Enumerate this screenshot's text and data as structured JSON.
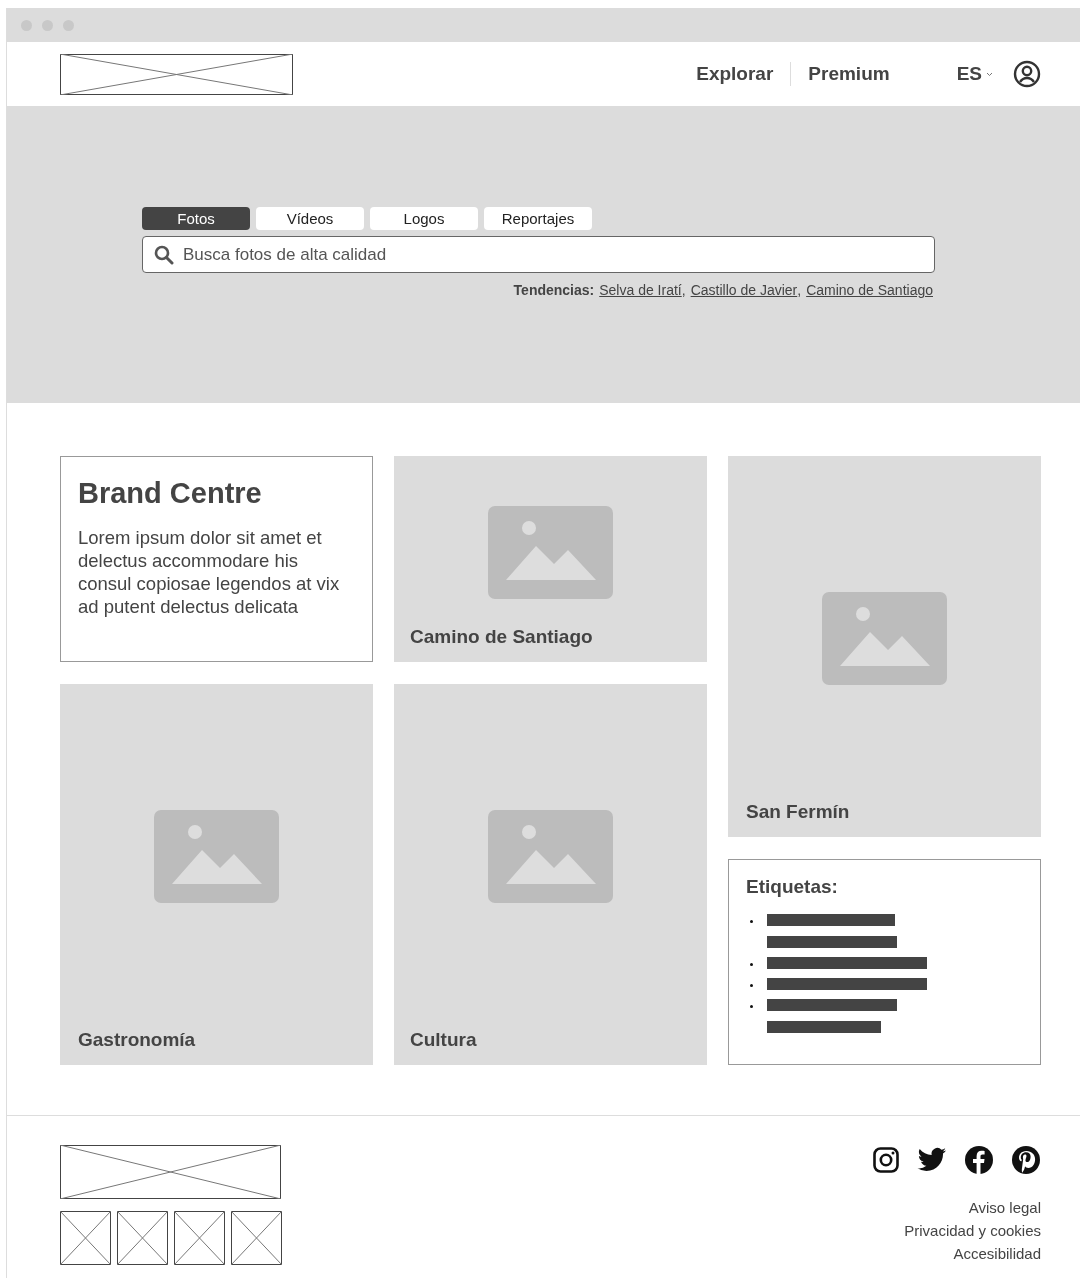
{
  "header": {
    "nav": [
      {
        "label": "Explorar"
      },
      {
        "label": "Premium"
      }
    ],
    "language": "ES"
  },
  "hero": {
    "tabs": [
      {
        "label": "Fotos",
        "selected": true
      },
      {
        "label": "Vídeos",
        "selected": false
      },
      {
        "label": "Logos",
        "selected": false
      },
      {
        "label": "Reportajes",
        "selected": false
      }
    ],
    "search": {
      "placeholder": "Busca fotos de alta calidad"
    },
    "trends_label": "Tendencias:",
    "trends_separator": ",",
    "trends": [
      "Selva de Iratí",
      "Castillo de Javier",
      "Camino de Santiago"
    ]
  },
  "intro": {
    "title": "Brand Centre",
    "text": "Lorem ipsum dolor sit amet et delectus accommodare his consul copiosae legendos at vix ad putent delectus delicata"
  },
  "tiles": [
    {
      "label": "Camino de Santiago",
      "kind": "picture"
    },
    {
      "label": "San Fermín",
      "kind": "picture"
    },
    {
      "label": "Gastronomía",
      "kind": "picture"
    },
    {
      "label": "Cultura",
      "kind": "picture"
    }
  ],
  "tags": {
    "title": "Etiquetas:",
    "items": [
      {
        "wrapped": true
      },
      {
        "wrapped": false
      },
      {
        "wrapped": false
      },
      {
        "wrapped": true
      }
    ]
  },
  "footer": {
    "links": [
      "Aviso legal",
      "Privacidad y cookies",
      "Accesibilidad"
    ]
  }
}
